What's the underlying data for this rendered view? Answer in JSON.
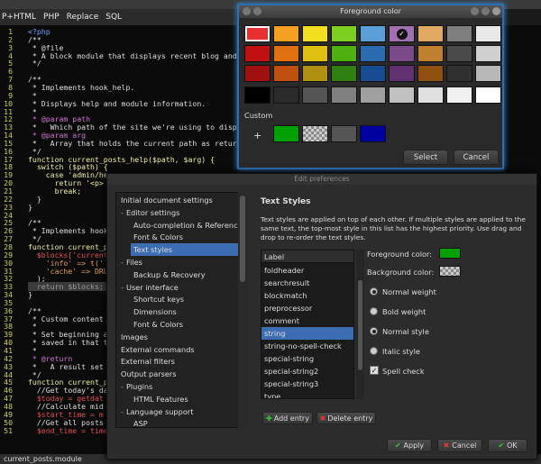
{
  "menu": [
    "P+HTML",
    "PHP",
    "Replace",
    "SQL"
  ],
  "editor": {
    "lines": [
      {
        "n": "1",
        "t": "<?php",
        "c": "#6aa0ff"
      },
      {
        "n": "2",
        "t": "/**",
        "c": "#ddd"
      },
      {
        "n": "3",
        "t": " * @file",
        "c": "#ddd"
      },
      {
        "n": "4",
        "t": " * A block module that displays recent blog and f",
        "c": "#ddd"
      },
      {
        "n": "5",
        "t": " */",
        "c": "#ddd"
      },
      {
        "n": "6",
        "t": "",
        "c": "#ddd"
      },
      {
        "n": "7",
        "t": "/**",
        "c": "#ddd"
      },
      {
        "n": "8",
        "t": " * Implements hook_help.",
        "c": "#ddd"
      },
      {
        "n": "9",
        "t": " *",
        "c": "#ddd"
      },
      {
        "n": "10",
        "t": " * Displays help and module information.",
        "c": "#ddd"
      },
      {
        "n": "11",
        "t": " *",
        "c": "#ddd"
      },
      {
        "n": "12",
        "t": " * @param path",
        "c": "#d070d0"
      },
      {
        "n": "13",
        "t": " *   Which path of the site we're using to displa",
        "c": "#ddd"
      },
      {
        "n": "14",
        "t": " * @param arg",
        "c": "#d070d0"
      },
      {
        "n": "15",
        "t": " *   Array that holds the current path as returne",
        "c": "#ddd"
      },
      {
        "n": "16",
        "t": " */",
        "c": "#ddd"
      },
      {
        "n": "17",
        "t": "function current_posts_help($path, $arg) {",
        "c": "#f0f0a0"
      },
      {
        "n": "18",
        "t": "  switch ($path) {",
        "c": "#f0f0a0"
      },
      {
        "n": "19",
        "t": "    case 'admin/he",
        "c": "#f0f0a0"
      },
      {
        "n": "20",
        "t": "      return '<p>",
        "c": "#f0f0a0"
      },
      {
        "n": "21",
        "t": "      break;",
        "c": "#f0f0a0"
      },
      {
        "n": "22",
        "t": "  }",
        "c": "#ddd"
      },
      {
        "n": "23",
        "t": "}",
        "c": "#ddd"
      },
      {
        "n": "24",
        "t": "",
        "c": "#ddd"
      },
      {
        "n": "25",
        "t": "/**",
        "c": "#ddd"
      },
      {
        "n": "26",
        "t": " * Implements hook_",
        "c": "#ddd"
      },
      {
        "n": "27",
        "t": " */",
        "c": "#ddd"
      },
      {
        "n": "28",
        "t": "function current_p",
        "c": "#f0f0a0"
      },
      {
        "n": "29",
        "t": "  $blocks['current",
        "c": "#e05050"
      },
      {
        "n": "30",
        "t": "    'info' => t('",
        "c": "#e0a050"
      },
      {
        "n": "31",
        "t": "    'cache' => DRU",
        "c": "#e0a050"
      },
      {
        "n": "32",
        "t": "  );",
        "c": "#ddd"
      },
      {
        "n": "33",
        "t": "  return $blocks;",
        "c": "#999"
      },
      {
        "n": "34",
        "t": "}",
        "c": "#ddd"
      },
      {
        "n": "35",
        "t": "",
        "c": "#ddd"
      },
      {
        "n": "36",
        "t": "/**",
        "c": "#ddd"
      },
      {
        "n": "37",
        "t": " * Custom content",
        "c": "#ddd"
      },
      {
        "n": "38",
        "t": " *",
        "c": "#ddd"
      },
      {
        "n": "39",
        "t": " * Set beginning an",
        "c": "#ddd"
      },
      {
        "n": "40",
        "t": " * saved in that ti",
        "c": "#ddd"
      },
      {
        "n": "41",
        "t": " *",
        "c": "#ddd"
      },
      {
        "n": "42",
        "t": " * @return",
        "c": "#d070d0"
      },
      {
        "n": "43",
        "t": " *   A result set o",
        "c": "#ddd"
      },
      {
        "n": "44",
        "t": " */",
        "c": "#ddd"
      },
      {
        "n": "45",
        "t": "function current_p",
        "c": "#f0f0a0"
      },
      {
        "n": "46",
        "t": "  //Get today's da",
        "c": "#ddd"
      },
      {
        "n": "47",
        "t": "  $today = getdat",
        "c": "#e05050"
      },
      {
        "n": "48",
        "t": "  //Calculate mid",
        "c": "#ddd"
      },
      {
        "n": "49",
        "t": "  $start_time = m",
        "c": "#e05050"
      },
      {
        "n": "50",
        "t": "  //Get all posts",
        "c": "#ddd"
      },
      {
        "n": "51",
        "t": "  $end_time = time",
        "c": "#e05050"
      }
    ]
  },
  "status": "current_posts.module",
  "fg_dialog": {
    "title": "Foreground color",
    "custom_label": "Custom",
    "add": "+",
    "select": "Select",
    "cancel": "Cancel",
    "palette": [
      [
        "#e83030",
        "#f4a020",
        "#f2e020",
        "#7ed020",
        "#5a9fd8",
        "#a070b0",
        "#e0a860",
        "#7e7e7e",
        "#e8e8e8"
      ],
      [
        "#c01010",
        "#e07010",
        "#e0c010",
        "#50b010",
        "#2c6cb0",
        "#7a4a8a",
        "#c08030",
        "#4a4a4a",
        "#d0d0d0"
      ],
      [
        "#a01010",
        "#c05010",
        "#b09010",
        "#308010",
        "#184c90",
        "#603070",
        "#905010",
        "#303030",
        "#b8b8b8"
      ],
      [
        "#000000",
        "#2a2a2a",
        "#555555",
        "#808080",
        "#a0a0a0",
        "#c0c0c0",
        "#e0e0e0",
        "#f0f0f0",
        "#ffffff"
      ]
    ],
    "custom": [
      "#00a000",
      "checker",
      "#555555",
      "#0000a0"
    ]
  },
  "prefs": {
    "title": "Edit preferences",
    "tree": [
      {
        "label": "Initial document settings",
        "lvl": 0
      },
      {
        "label": "Editor settings",
        "lvl": 0,
        "exp": "-"
      },
      {
        "label": "Auto-completion & Reference",
        "lvl": 1
      },
      {
        "label": "Font & Colors",
        "lvl": 1
      },
      {
        "label": "Text styles",
        "lvl": 1,
        "sel": true
      },
      {
        "label": "Files",
        "lvl": 0,
        "exp": "-"
      },
      {
        "label": "Backup & Recovery",
        "lvl": 1
      },
      {
        "label": "User interface",
        "lvl": 0,
        "exp": "-"
      },
      {
        "label": "Shortcut keys",
        "lvl": 1
      },
      {
        "label": "Dimensions",
        "lvl": 1
      },
      {
        "label": "Font & Colors",
        "lvl": 1
      },
      {
        "label": "Images",
        "lvl": 0
      },
      {
        "label": "External commands",
        "lvl": 0
      },
      {
        "label": "External filters",
        "lvl": 0
      },
      {
        "label": "Output parsers",
        "lvl": 0
      },
      {
        "label": "Plugins",
        "lvl": 0,
        "exp": "-"
      },
      {
        "label": "HTML Features",
        "lvl": 1
      },
      {
        "label": "Language support",
        "lvl": 0,
        "exp": "-"
      },
      {
        "label": "ASP",
        "lvl": 1
      }
    ],
    "heading": "Text Styles",
    "desc": "Text styles are applied on top of each other. If multiple styles are applied to the same text, the top-most style in this list has the highest priority. Use drag and drop to re-order the text styles.",
    "list_header": "Label",
    "styles": [
      "foldheader",
      "searchresult",
      "blockmatch",
      "preprocessor",
      "comment",
      "string",
      "string-no-spell-check",
      "special-string",
      "special-string2",
      "special-string3",
      "type"
    ],
    "selected_style": "string",
    "fg_label": "Foreground color:",
    "bg_label": "Background color:",
    "fg_color": "#00a000",
    "weight": [
      "Normal weight",
      "Bold weight"
    ],
    "style": [
      "Normal style",
      "Italic style"
    ],
    "spell": "Spell check",
    "add": "Add entry",
    "delete": "Delete entry",
    "apply": "Apply",
    "cancel": "Cancel",
    "ok": "OK"
  }
}
